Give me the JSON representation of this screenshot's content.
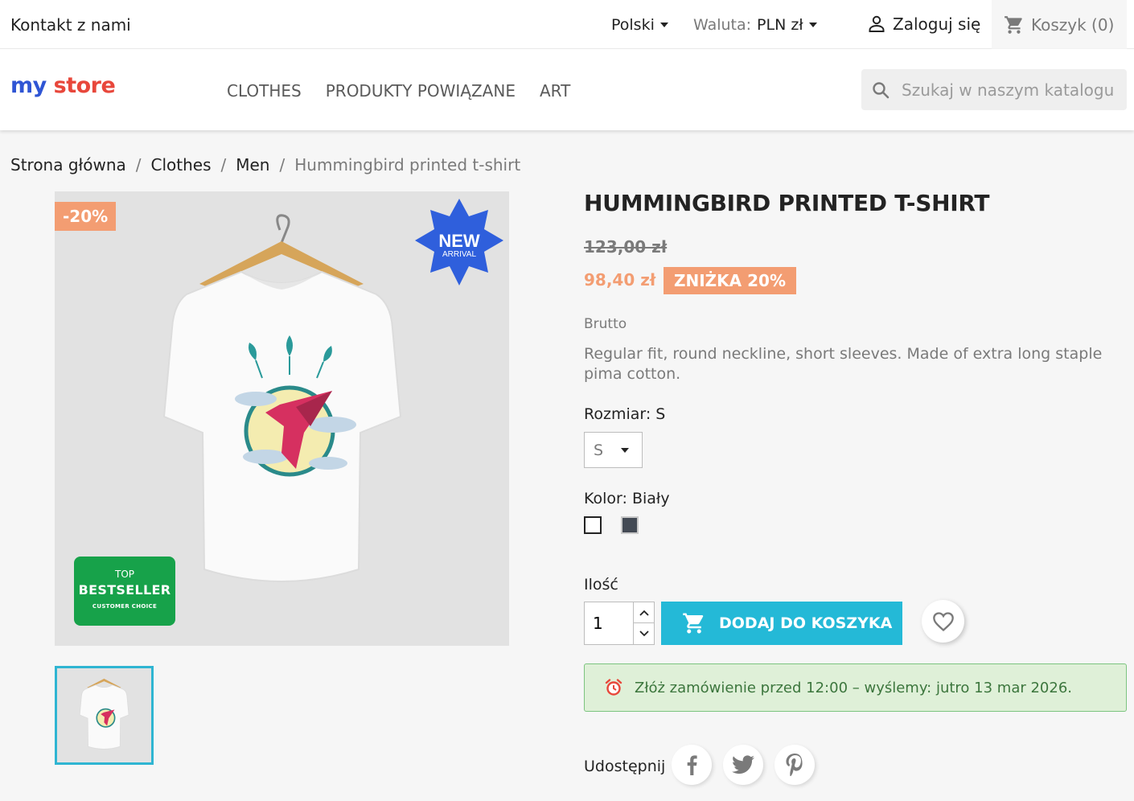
{
  "topbar": {
    "contact": "Kontakt z nami",
    "language": "Polski",
    "currency_label": "Waluta:",
    "currency_value": "PLN zł",
    "login": "Zaloguj się",
    "cart": "Koszyk (0)"
  },
  "header": {
    "logo_my": "my",
    "logo_store": "store",
    "nav": [
      "Clothes",
      "Produkty powiązane",
      "Art"
    ],
    "search_placeholder": "Szukaj w naszym katalogu"
  },
  "breadcrumb": [
    "Strona główna",
    "Clothes",
    "Men",
    "Hummingbird printed t-shirt"
  ],
  "product": {
    "title": "Hummingbird printed t-shirt",
    "old_price": "123,00 zł",
    "price": "98,40 zł",
    "discount_label": "Zniżka 20%",
    "image_flag": "-20%",
    "tax_label": "Brutto",
    "description": "Regular fit, round neckline, short sleeves. Made of extra long staple pima cotton.",
    "new_badge": {
      "line1": "NEW",
      "line2": "ARRIVAL"
    },
    "bestseller_badge": {
      "line1": "TOP",
      "line2": "BESTSELLER",
      "line3": "CUSTOMER CHOICE"
    },
    "size_label": "Rozmiar: S",
    "size_selected": "S",
    "color_label": "Kolor: Biały",
    "colors": [
      "#ffffff",
      "#434a54"
    ],
    "qty_label": "Ilość",
    "qty_value": "1",
    "add_to_cart": "Dodaj do koszyka"
  },
  "shipping_notice": "Złóż zamówienie przed 12:00 – wyślemy: jutro 13 mar 2026.",
  "share": {
    "label": "Udostępnij",
    "networks": [
      "facebook-icon",
      "twitter-icon",
      "pinterest-icon"
    ]
  },
  "colors": {
    "accent": "#24b9d7",
    "discount": "#f39d72",
    "notice_bg": "#dff0d8"
  }
}
